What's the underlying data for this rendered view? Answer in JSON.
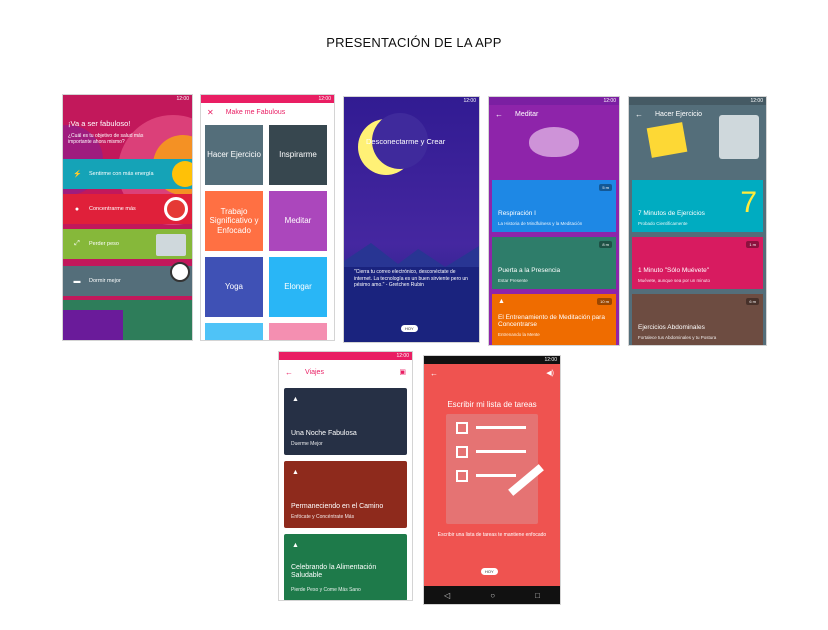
{
  "page": {
    "title": "PRESENTACIÓN DE LA APP"
  },
  "status_time": "12:00",
  "screen1": {
    "headline": "¡Va a ser fabuloso!",
    "subtext": "¿Cuál es tu objetivo de salud más importante ahora mismo?",
    "options": [
      {
        "label": "Sentirme con más energía",
        "icon": "lightning-icon",
        "color": "#15a3b7"
      },
      {
        "label": "Concentrarme más",
        "icon": "target-icon",
        "color": "#e0203a"
      },
      {
        "label": "Perder peso",
        "icon": "scale-icon",
        "color": "#86b83a"
      },
      {
        "label": "Dormir mejor",
        "icon": "bed-icon",
        "color": "#546e7a"
      }
    ]
  },
  "screen2": {
    "title": "Make me Fabulous",
    "tiles": [
      "Hacer Ejercicio",
      "Inspirarme",
      "Trabajo Significativo y Enfocado",
      "Meditar",
      "Yoga",
      "Elongar"
    ]
  },
  "screen3": {
    "title": "Desconectarme y Crear",
    "quote": "\"Cierra tu correo electrónico, desconéctate de internet. La tecnología es un buen sirviente pero un pésimo amo.\" - Gretchen Rubin",
    "button": "HOY"
  },
  "screen4": {
    "title": "Meditar",
    "cards": [
      {
        "title": "Respiración I",
        "subtitle": "La Historia de Mindfulness y la Meditación",
        "badge": "5 m"
      },
      {
        "title": "Puerta a la Presencia",
        "subtitle": "Estar Presente",
        "badge": "8 m"
      },
      {
        "title": "El Entrenamiento de Meditación para Concentrarse",
        "subtitle": "Entrenando la Mente",
        "badge": "10 m"
      }
    ]
  },
  "screen5": {
    "title": "Hacer Ejercicio",
    "cards": [
      {
        "title": "7 Minutos de Ejercicios",
        "subtitle": "Probado Científicamente",
        "badge": ""
      },
      {
        "title": "1 Minuto \"Sólo Muévete\"",
        "subtitle": "Muévete, aunque sea por un minuto",
        "badge": "1 m"
      },
      {
        "title": "Ejercicios Abdominales",
        "subtitle": "Fortalece tus Abdominales y tu Postura",
        "badge": "6 m"
      }
    ]
  },
  "screen6": {
    "title": "Viajes",
    "cards": [
      {
        "title": "Una Noche Fabulosa",
        "subtitle": "Duerme Mejor"
      },
      {
        "title": "Permaneciendo en el Camino",
        "subtitle": "Enfócate y Concéntrate Más"
      },
      {
        "title": "Celebrando la Alimentación Saludable",
        "subtitle": "Pierde Peso y Come Más Sano"
      }
    ]
  },
  "screen7": {
    "title": "Escribir mi lista de tareas",
    "description": "Escribir una lista de tareas te mantiene enfocado",
    "button": "HOY"
  }
}
